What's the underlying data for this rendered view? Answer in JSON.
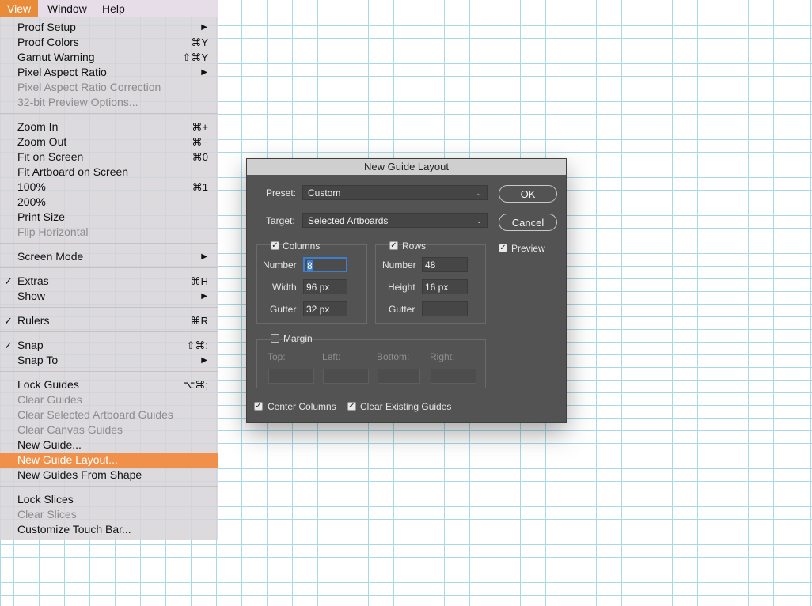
{
  "menubar": {
    "items": [
      "View",
      "Window",
      "Help"
    ],
    "active": "View"
  },
  "menu": {
    "items": [
      {
        "label": "Proof Setup",
        "shortcut": "",
        "submenu": true,
        "checked": false,
        "disabled": false
      },
      {
        "label": "Proof Colors",
        "shortcut": "⌘Y",
        "submenu": false,
        "checked": false,
        "disabled": false
      },
      {
        "label": "Gamut Warning",
        "shortcut": "⇧⌘Y",
        "submenu": false,
        "checked": false,
        "disabled": false
      },
      {
        "label": "Pixel Aspect Ratio",
        "shortcut": "",
        "submenu": true,
        "checked": false,
        "disabled": false
      },
      {
        "label": "Pixel Aspect Ratio Correction",
        "shortcut": "",
        "submenu": false,
        "checked": false,
        "disabled": true
      },
      {
        "label": "32-bit Preview Options...",
        "shortcut": "",
        "submenu": false,
        "checked": false,
        "disabled": true
      },
      {
        "label": "Zoom In",
        "shortcut": "⌘+",
        "submenu": false,
        "checked": false,
        "disabled": false
      },
      {
        "label": "Zoom Out",
        "shortcut": "⌘−",
        "submenu": false,
        "checked": false,
        "disabled": false
      },
      {
        "label": "Fit on Screen",
        "shortcut": "⌘0",
        "submenu": false,
        "checked": false,
        "disabled": false
      },
      {
        "label": "Fit Artboard on Screen",
        "shortcut": "",
        "submenu": false,
        "checked": false,
        "disabled": false
      },
      {
        "label": "100%",
        "shortcut": "⌘1",
        "submenu": false,
        "checked": false,
        "disabled": false
      },
      {
        "label": "200%",
        "shortcut": "",
        "submenu": false,
        "checked": false,
        "disabled": false
      },
      {
        "label": "Print Size",
        "shortcut": "",
        "submenu": false,
        "checked": false,
        "disabled": false
      },
      {
        "label": "Flip Horizontal",
        "shortcut": "",
        "submenu": false,
        "checked": false,
        "disabled": true
      },
      {
        "label": "Screen Mode",
        "shortcut": "",
        "submenu": true,
        "checked": false,
        "disabled": false
      },
      {
        "label": "Extras",
        "shortcut": "⌘H",
        "submenu": false,
        "checked": true,
        "disabled": false
      },
      {
        "label": "Show",
        "shortcut": "",
        "submenu": true,
        "checked": false,
        "disabled": false
      },
      {
        "label": "Rulers",
        "shortcut": "⌘R",
        "submenu": false,
        "checked": true,
        "disabled": false
      },
      {
        "label": "Snap",
        "shortcut": "⇧⌘;",
        "submenu": false,
        "checked": true,
        "disabled": false
      },
      {
        "label": "Snap To",
        "shortcut": "",
        "submenu": true,
        "checked": false,
        "disabled": false
      },
      {
        "label": "Lock Guides",
        "shortcut": "⌥⌘;",
        "submenu": false,
        "checked": false,
        "disabled": false
      },
      {
        "label": "Clear Guides",
        "shortcut": "",
        "submenu": false,
        "checked": false,
        "disabled": true
      },
      {
        "label": "Clear Selected Artboard Guides",
        "shortcut": "",
        "submenu": false,
        "checked": false,
        "disabled": true
      },
      {
        "label": "Clear Canvas Guides",
        "shortcut": "",
        "submenu": false,
        "checked": false,
        "disabled": true
      },
      {
        "label": "New Guide...",
        "shortcut": "",
        "submenu": false,
        "checked": false,
        "disabled": false
      },
      {
        "label": "New Guide Layout...",
        "shortcut": "",
        "submenu": false,
        "checked": false,
        "disabled": false,
        "highlighted": true
      },
      {
        "label": "New Guides From Shape",
        "shortcut": "",
        "submenu": false,
        "checked": false,
        "disabled": false
      },
      {
        "label": "Lock Slices",
        "shortcut": "",
        "submenu": false,
        "checked": false,
        "disabled": false
      },
      {
        "label": "Clear Slices",
        "shortcut": "",
        "submenu": false,
        "checked": false,
        "disabled": true
      },
      {
        "label": "Customize Touch Bar...",
        "shortcut": "",
        "submenu": false,
        "checked": false,
        "disabled": false
      }
    ]
  },
  "dialog": {
    "title": "New Guide Layout",
    "preset_label": "Preset:",
    "preset_value": "Custom",
    "target_label": "Target:",
    "target_value": "Selected Artboards",
    "ok": "OK",
    "cancel": "Cancel",
    "preview": "Preview",
    "columns": {
      "label": "Columns",
      "number_label": "Number",
      "number": "8",
      "width_label": "Width",
      "width": "96 px",
      "gutter_label": "Gutter",
      "gutter": "32 px"
    },
    "rows": {
      "label": "Rows",
      "number_label": "Number",
      "number": "48",
      "height_label": "Height",
      "height": "16 px",
      "gutter_label": "Gutter",
      "gutter": ""
    },
    "margin": {
      "label": "Margin",
      "top": "Top:",
      "left": "Left:",
      "bottom": "Bottom:",
      "right": "Right:"
    },
    "center_columns": "Center Columns",
    "clear_existing": "Clear Existing Guides"
  },
  "colors": {
    "guide": "#a9d8e6",
    "menu_active": "#e98c39",
    "menu_highlight": "#f0904a",
    "dialog_bg": "#535353"
  }
}
